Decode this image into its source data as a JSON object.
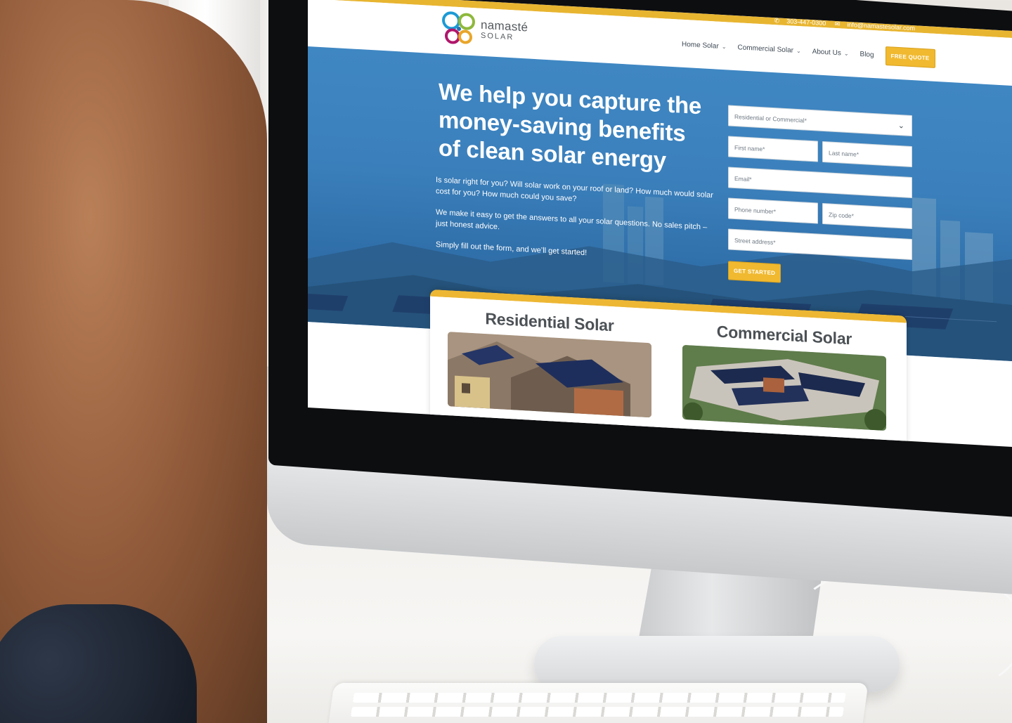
{
  "site": {
    "topbar": {
      "phone": "303-447-0300",
      "email": "info@namastesolar.com"
    },
    "logo": {
      "word": "namasté",
      "sub": "SOLAR"
    },
    "nav": [
      {
        "label": "Home Solar",
        "dropdown": true
      },
      {
        "label": "Commercial Solar",
        "dropdown": true
      },
      {
        "label": "About Us",
        "dropdown": true
      },
      {
        "label": "Blog",
        "dropdown": false
      }
    ],
    "cta": "FREE QUOTE",
    "hero": {
      "title": "We help you capture the money-saving benefits of clean solar energy",
      "paragraph1": "Is solar right for you? Will solar work on your roof or land? How much would solar cost for you? How much could you save?",
      "paragraph2": "We make it easy to get the answers to all your solar questions. No sales pitch – just honest advice.",
      "paragraph3": "Simply fill out the form, and we’ll get started!"
    },
    "form": {
      "select_placeholder": "Residential or Commercial*",
      "first_name": "First name*",
      "last_name": "Last name*",
      "email": "Email*",
      "phone": "Phone number*",
      "zip": "Zip code*",
      "street": "Street address*",
      "submit": "GET STARTED"
    },
    "cards": [
      {
        "title": "Residential Solar"
      },
      {
        "title": "Commercial Solar"
      }
    ]
  },
  "colors": {
    "accent": "#f0b92f",
    "hero_blue": "#3b80bc",
    "text_dark": "#4c5155"
  },
  "icons": {
    "phone": "phone-icon",
    "email": "envelope-icon",
    "chevron": "chevron-down-icon"
  }
}
